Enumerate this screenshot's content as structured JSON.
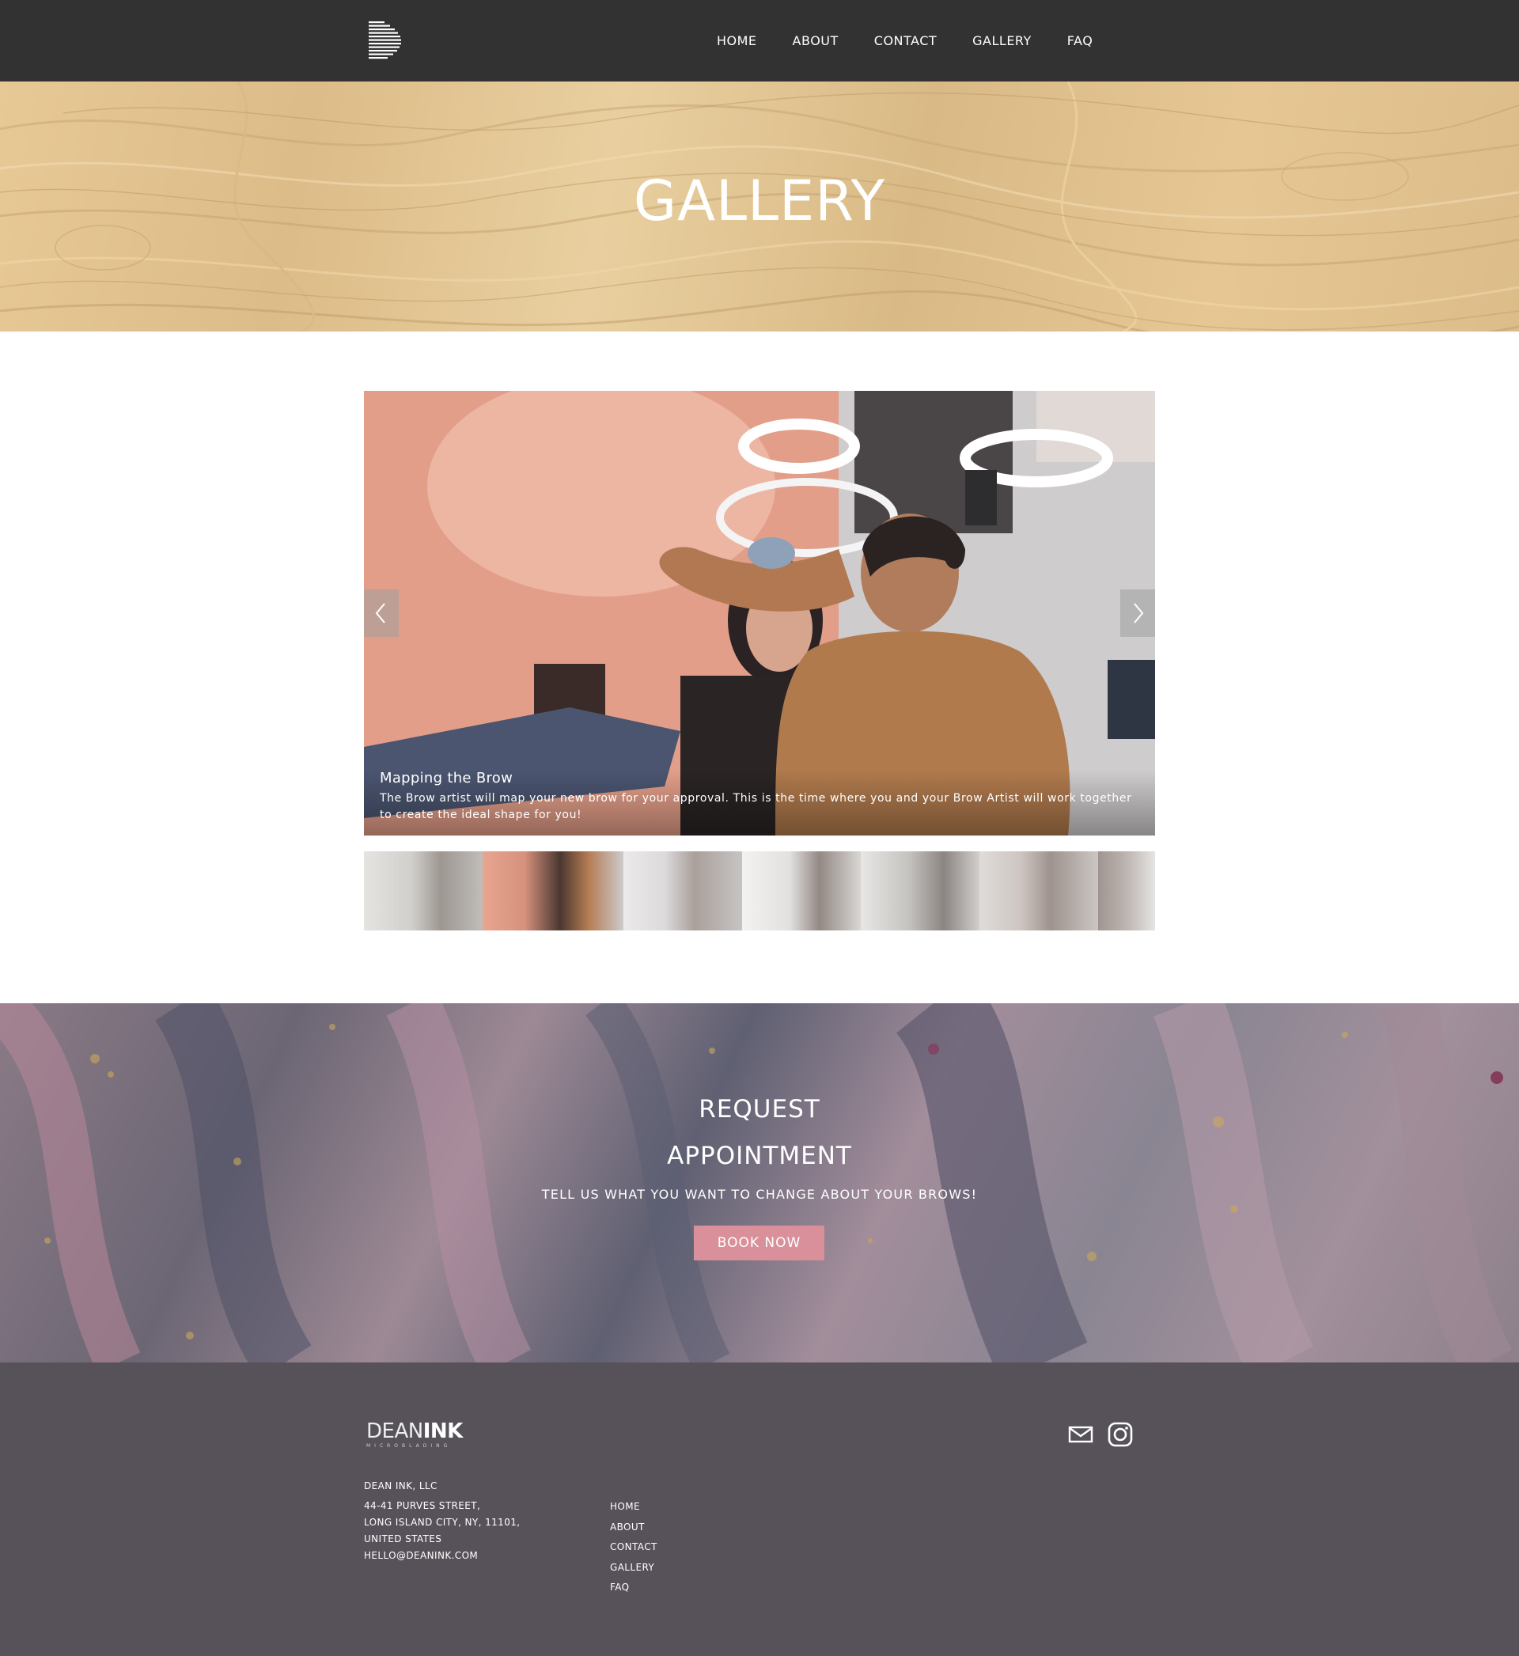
{
  "header": {
    "logo_icon": "striped-d-logo",
    "nav": [
      {
        "label": "HOME"
      },
      {
        "label": "ABOUT"
      },
      {
        "label": "CONTACT"
      },
      {
        "label": "GALLERY"
      },
      {
        "label": "FAQ"
      }
    ]
  },
  "hero": {
    "title": "GALLERY"
  },
  "slider": {
    "prev_icon": "chevron-left-icon",
    "next_icon": "chevron-right-icon",
    "caption": {
      "title": "Mapping the Brow",
      "text": "The Brow artist will map your new brow for your approval. This is the time where you and your Brow Artist will work together to create the ideal shape for you!"
    },
    "thumbnail_count": 7,
    "active_thumbnail_index": 1
  },
  "appointment": {
    "title_line1": "REQUEST",
    "title_line2": "APPOINTMENT",
    "subtitle": "TELL US WHAT YOU WANT TO CHANGE ABOUT YOUR BROWS!",
    "button_label": "BOOK NOW",
    "button_color": "#d9909a"
  },
  "footer": {
    "logo_part1": "DEAN",
    "logo_part2": "INK",
    "logo_tagline": "MICROBLADING",
    "company": "DEAN INK, LLC",
    "address_line1": "44-41 PURVES STREET,",
    "address_line2": "LONG ISLAND CITY, NY, 11101,",
    "address_line3": "UNITED STATES",
    "email": "HELLO@DEANINK.COM",
    "nav": [
      {
        "label": "HOME"
      },
      {
        "label": "ABOUT"
      },
      {
        "label": "CONTACT"
      },
      {
        "label": "GALLERY"
      },
      {
        "label": "FAQ"
      }
    ],
    "social_icons": [
      "mail-icon",
      "instagram-icon"
    ]
  },
  "colors": {
    "header_bg": "#333233",
    "footer_bg": "#57525a",
    "accent_pink": "#d9909a"
  }
}
